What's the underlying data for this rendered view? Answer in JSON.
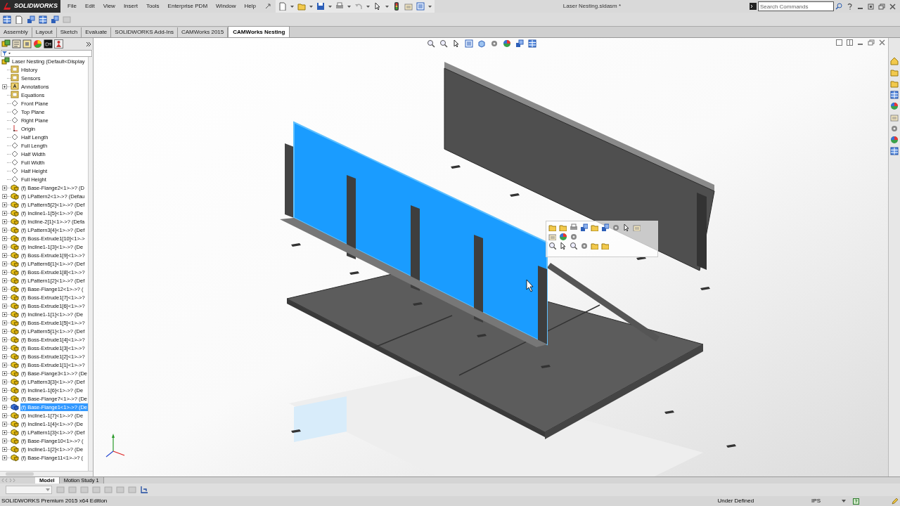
{
  "window": {
    "title": "Laser Nesting.sldasm *",
    "app_logo": "SOLIDWORKS"
  },
  "menu": [
    "File",
    "Edit",
    "View",
    "Insert",
    "Tools",
    "Enterprise PDM",
    "Window",
    "Help"
  ],
  "search": {
    "placeholder": "Search Commands"
  },
  "command_tabs": [
    {
      "label": "Assembly",
      "selected": false
    },
    {
      "label": "Layout",
      "selected": false
    },
    {
      "label": "Sketch",
      "selected": false
    },
    {
      "label": "Evaluate",
      "selected": false
    },
    {
      "label": "SOLIDWORKS Add-Ins",
      "selected": false
    },
    {
      "label": "CAMWorks 2015",
      "selected": false
    },
    {
      "label": "CAMWorks Nesting",
      "selected": true
    }
  ],
  "feature_tree": [
    {
      "label": "Laser Nesting  (Default<Display",
      "kind": "assembly",
      "selected": false
    },
    {
      "label": "History",
      "kind": "folder",
      "collapsed": false,
      "selected": false
    },
    {
      "label": "Sensors",
      "kind": "folder",
      "collapsed": false,
      "selected": false
    },
    {
      "label": "Annotations",
      "kind": "annotation",
      "collapsed": true,
      "selected": false
    },
    {
      "label": "Equations",
      "kind": "folder",
      "collapsed": false,
      "selected": false
    },
    {
      "label": "Front Plane",
      "kind": "plane",
      "collapsed": false,
      "selected": false
    },
    {
      "label": "Top Plane",
      "kind": "plane",
      "collapsed": false,
      "selected": false
    },
    {
      "label": "Right Plane",
      "kind": "plane",
      "collapsed": false,
      "selected": false
    },
    {
      "label": "Origin",
      "kind": "origin",
      "collapsed": false,
      "selected": false
    },
    {
      "label": "Half Length",
      "kind": "plane",
      "collapsed": false,
      "selected": false
    },
    {
      "label": "Full Length",
      "kind": "plane",
      "collapsed": false,
      "selected": false
    },
    {
      "label": "Half Width",
      "kind": "plane",
      "collapsed": false,
      "selected": false
    },
    {
      "label": "Full Width",
      "kind": "plane",
      "collapsed": false,
      "selected": false
    },
    {
      "label": "Half Height",
      "kind": "plane",
      "collapsed": false,
      "selected": false
    },
    {
      "label": "Full Height",
      "kind": "plane",
      "collapsed": false,
      "selected": false
    },
    {
      "label": "(f) Base-Flange2<1>->? (D",
      "kind": "part",
      "collapsed": true,
      "selected": false
    },
    {
      "label": "(f) LPattern2<1>->? (Defau",
      "kind": "part",
      "collapsed": true,
      "selected": false
    },
    {
      "label": "(f) LPattern5[2]<1>->? (Def",
      "kind": "part",
      "collapsed": true,
      "selected": false
    },
    {
      "label": "(f) Incline1-1[5]<1>->? (De",
      "kind": "part",
      "collapsed": true,
      "selected": false
    },
    {
      "label": "(f) Incline-2[1]<1>->? (Defa",
      "kind": "part",
      "collapsed": true,
      "selected": false
    },
    {
      "label": "(f) LPattern3[4]<1>->? (Def",
      "kind": "part",
      "collapsed": true,
      "selected": false
    },
    {
      "label": "(f) Boss-Extrude1[10]<1>->",
      "kind": "part",
      "collapsed": true,
      "selected": false
    },
    {
      "label": "(f) Incline1-1[3]<1>->? (De",
      "kind": "part",
      "collapsed": true,
      "selected": false
    },
    {
      "label": "(f) Boss-Extrude1[9]<1>->?",
      "kind": "part",
      "collapsed": true,
      "selected": false
    },
    {
      "label": "(f) LPattern6[1]<1>->? (Def",
      "kind": "part",
      "collapsed": true,
      "selected": false
    },
    {
      "label": "(f) Boss-Extrude1[8]<1>->?",
      "kind": "part",
      "collapsed": true,
      "selected": false
    },
    {
      "label": "(f) LPattern1[2]<1>->? (Def",
      "kind": "part",
      "collapsed": true,
      "selected": false
    },
    {
      "label": "(f) Base-Flange12<1>->? (",
      "kind": "part",
      "collapsed": true,
      "selected": false
    },
    {
      "label": "(f) Boss-Extrude1[7]<1>->?",
      "kind": "part",
      "collapsed": true,
      "selected": false
    },
    {
      "label": "(f) Boss-Extrude1[6]<1>->?",
      "kind": "part",
      "collapsed": true,
      "selected": false
    },
    {
      "label": "(f) Incline1-1[1]<1>->? (De",
      "kind": "part",
      "collapsed": true,
      "selected": false
    },
    {
      "label": "(f) Boss-Extrude1[5]<1>->?",
      "kind": "part",
      "collapsed": true,
      "selected": false
    },
    {
      "label": "(f) LPattern5[1]<1>->? (Def",
      "kind": "part",
      "collapsed": true,
      "selected": false
    },
    {
      "label": "(f) Boss-Extrude1[4]<1>->?",
      "kind": "part",
      "collapsed": true,
      "selected": false
    },
    {
      "label": "(f) Boss-Extrude1[3]<1>->?",
      "kind": "part",
      "collapsed": true,
      "selected": false
    },
    {
      "label": "(f) Boss-Extrude1[2]<1>->?",
      "kind": "part",
      "collapsed": true,
      "selected": false
    },
    {
      "label": "(f) Boss-Extrude1[1]<1>->?",
      "kind": "part",
      "collapsed": true,
      "selected": false
    },
    {
      "label": "(f) Base-Flange3<1>->? (De",
      "kind": "part",
      "collapsed": true,
      "selected": false
    },
    {
      "label": "(f) LPattern3[3]<1>->? (Def",
      "kind": "part",
      "collapsed": true,
      "selected": false
    },
    {
      "label": "(f) Incline1-1[6]<1>->? (De",
      "kind": "part",
      "collapsed": true,
      "selected": false
    },
    {
      "label": "(f) Base-Flange7<1>->? (De",
      "kind": "part",
      "collapsed": true,
      "selected": false
    },
    {
      "label": "(f) Base-Flange1<1>->? (De",
      "kind": "part",
      "collapsed": true,
      "selected": true
    },
    {
      "label": "(f) Incline1-1[7]<1>->? (De",
      "kind": "part",
      "collapsed": true,
      "selected": false
    },
    {
      "label": "(f) Incline1-1[4]<1>->? (De",
      "kind": "part",
      "collapsed": true,
      "selected": false
    },
    {
      "label": "(f) LPattern1[3]<1>->? (Def",
      "kind": "part",
      "collapsed": true,
      "selected": false
    },
    {
      "label": "(f) Base-Flange10<1>->? (",
      "kind": "part",
      "collapsed": true,
      "selected": false
    },
    {
      "label": "(f) Incline1-1[2]<1>->? (De",
      "kind": "part",
      "collapsed": true,
      "selected": false
    },
    {
      "label": "(f) Base-Flange11<1>->? (",
      "kind": "part",
      "collapsed": true,
      "selected": false
    }
  ],
  "bottom_tabs": [
    {
      "label": "Model",
      "selected": true
    },
    {
      "label": "Motion Study 1",
      "selected": false
    }
  ],
  "status_bar": {
    "edition": "SOLIDWORKS Premium 2015 x64 Edition",
    "state": "Under Defined",
    "units": "IPS"
  }
}
